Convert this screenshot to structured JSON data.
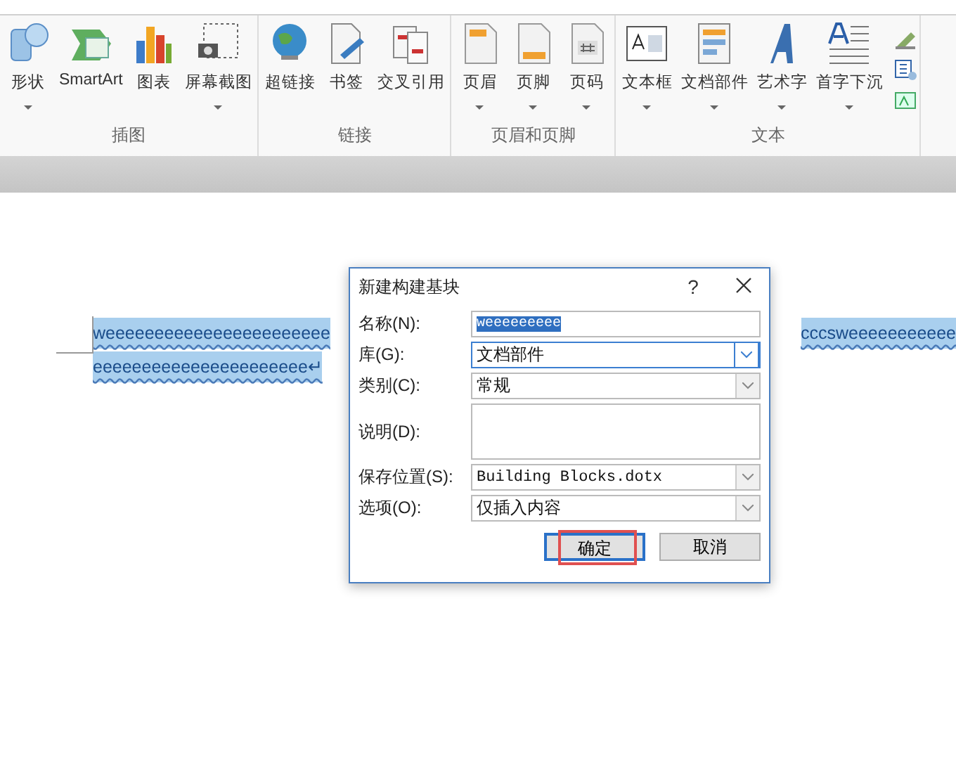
{
  "ribbon": {
    "groups": [
      {
        "label": "插图",
        "buttons": [
          {
            "label": "形状",
            "has_dropdown": true
          },
          {
            "label": "SmartArt",
            "has_dropdown": false
          },
          {
            "label": "图表",
            "has_dropdown": false
          },
          {
            "label": "屏幕截图",
            "has_dropdown": true
          }
        ]
      },
      {
        "label": "链接",
        "buttons": [
          {
            "label": "超链接",
            "has_dropdown": false
          },
          {
            "label": "书签",
            "has_dropdown": false
          },
          {
            "label": "交叉引用",
            "has_dropdown": false
          }
        ]
      },
      {
        "label": "页眉和页脚",
        "buttons": [
          {
            "label": "页眉",
            "has_dropdown": true
          },
          {
            "label": "页脚",
            "has_dropdown": true
          },
          {
            "label": "页码",
            "has_dropdown": true
          }
        ]
      },
      {
        "label": "文本",
        "buttons": [
          {
            "label": "文本框",
            "has_dropdown": true
          },
          {
            "label": "文档部件",
            "has_dropdown": true
          },
          {
            "label": "艺术字",
            "has_dropdown": true
          },
          {
            "label": "首字下沉",
            "has_dropdown": true
          }
        ]
      }
    ]
  },
  "document": {
    "lines": [
      {
        "left": "weeeeeeeeeeeeeeeeeeeeeee",
        "right": "cccsweeeeeeeeeee",
        "selected": true
      },
      {
        "left": "eeeeeeeeeeeeeeeeeeeeee↵",
        "selected": true
      }
    ]
  },
  "dialog": {
    "title": "新建构建基块",
    "help": "?",
    "fields": [
      {
        "label": "名称(N):",
        "kind": "text",
        "value": "weeeeeeeee",
        "focused": false,
        "text_highlighted": true
      },
      {
        "label": "库(G):",
        "kind": "combo",
        "value": "文档部件",
        "focused": true,
        "text_highlighted": false
      },
      {
        "label": "类别(C):",
        "kind": "combo",
        "value": "常规",
        "focused": false,
        "text_highlighted": false
      },
      {
        "label": "说明(D):",
        "kind": "textarea",
        "focused": false
      },
      {
        "label": "保存位置(S):",
        "kind": "combo",
        "value": "Building Blocks.dotx",
        "focused": false,
        "text_highlighted": false
      },
      {
        "label": "选项(O):",
        "kind": "combo",
        "value": "仅插入内容",
        "focused": false,
        "text_highlighted": false
      }
    ],
    "buttons": [
      {
        "label": "确定",
        "default": true,
        "annotated": true
      },
      {
        "label": "取消",
        "default": false,
        "annotated": false
      }
    ]
  }
}
